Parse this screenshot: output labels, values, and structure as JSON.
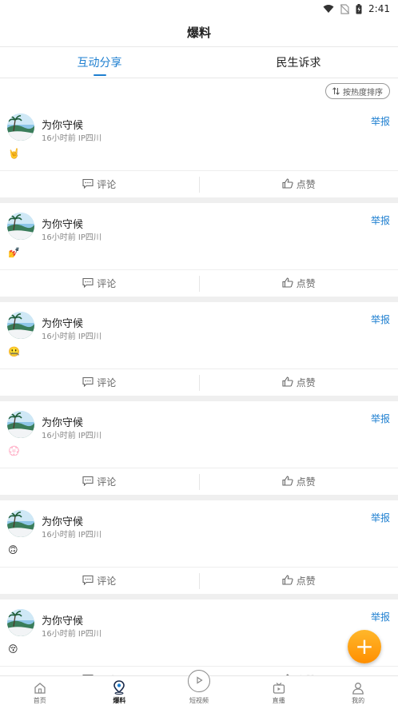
{
  "status_bar": {
    "time": "2:41"
  },
  "header": {
    "title": "爆料"
  },
  "tabs": [
    {
      "label": "互动分享",
      "active": true
    },
    {
      "label": "民生诉求",
      "active": false
    }
  ],
  "sort_button": {
    "label": "按热度排序"
  },
  "posts": [
    {
      "author": "为你守候",
      "time_ago": "16小时前",
      "location": "IP四川",
      "report_label": "举报",
      "emoji": "🤘",
      "comment_label": "评论",
      "like_label": "点赞"
    },
    {
      "author": "为你守候",
      "time_ago": "16小时前",
      "location": "IP四川",
      "report_label": "举报",
      "emoji": "💅",
      "comment_label": "评论",
      "like_label": "点赞"
    },
    {
      "author": "为你守候",
      "time_ago": "16小时前",
      "location": "IP四川",
      "report_label": "举报",
      "emoji": "🤐",
      "comment_label": "评论",
      "like_label": "点赞"
    },
    {
      "author": "为你守候",
      "time_ago": "16小时前",
      "location": "IP四川",
      "report_label": "举报",
      "emoji": "💮",
      "comment_label": "评论",
      "like_label": "点赞"
    },
    {
      "author": "为你守候",
      "time_ago": "16小时前",
      "location": "IP四川",
      "report_label": "举报",
      "emoji": "🙃",
      "comment_label": "评论",
      "like_label": "点赞"
    },
    {
      "author": "为你守候",
      "time_ago": "16小时前",
      "location": "IP四川",
      "report_label": "举报",
      "emoji": "😚",
      "comment_label": "评论",
      "like_label": "点赞"
    }
  ],
  "fab": {
    "icon": "plus-icon",
    "color": "#ff9f1a"
  },
  "bottom_nav": [
    {
      "label": "首页",
      "icon": "home-icon",
      "active": false
    },
    {
      "label": "爆料",
      "icon": "location-pin-icon",
      "active": true
    },
    {
      "label": "短视频",
      "icon": "play-icon",
      "active": false
    },
    {
      "label": "直播",
      "icon": "tv-icon",
      "active": false
    },
    {
      "label": "我的",
      "icon": "user-icon",
      "active": false
    }
  ],
  "colors": {
    "accent": "#1e7fd0",
    "separator": "#efefef"
  }
}
